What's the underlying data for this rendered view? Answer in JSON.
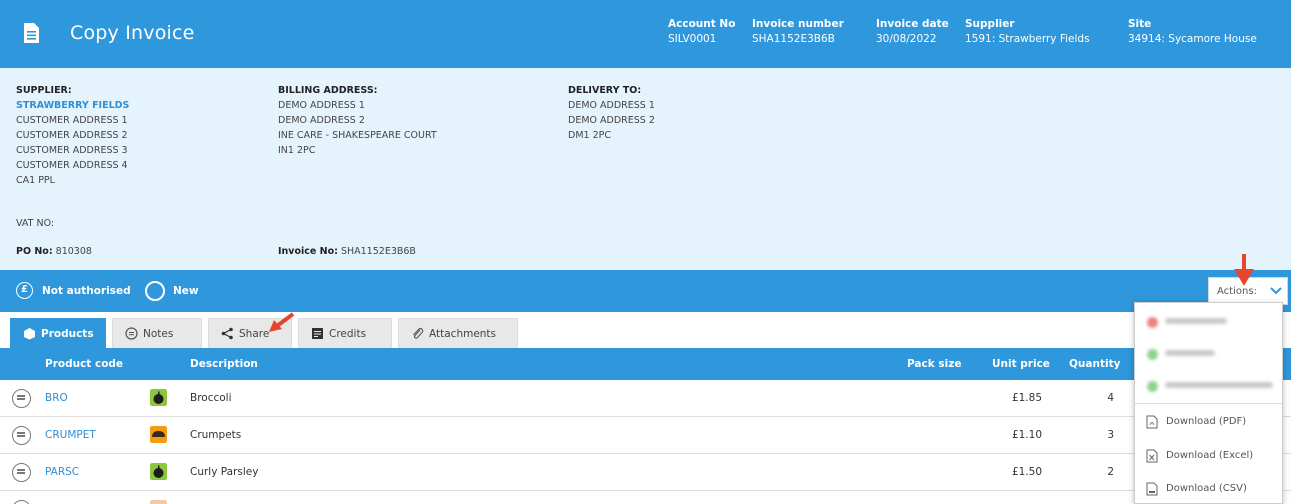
{
  "header": {
    "title": "Copy Invoice",
    "account_no_label": "Account No",
    "account_no": "SILV0001",
    "invoice_number_label": "Invoice number",
    "invoice_number": "SHA1152E3B6B",
    "invoice_date_label": "Invoice date",
    "invoice_date": "30/08/2022",
    "supplier_label": "Supplier",
    "supplier": "1591: Strawberry Fields",
    "site_label": "Site",
    "site": "34914: Sycamore House"
  },
  "supplier": {
    "heading": "SUPPLIER:",
    "name": "STRAWBERRY FIELDS",
    "lines": [
      "CUSTOMER ADDRESS 1",
      "CUSTOMER ADDRESS 2",
      "CUSTOMER ADDRESS 3",
      "CUSTOMER ADDRESS 4",
      "CA1 PPL"
    ],
    "vat_label": "VAT NO:",
    "po_label": "PO No:",
    "po_value": "810308"
  },
  "billing": {
    "heading": "BILLING ADDRESS:",
    "lines": [
      "DEMO ADDRESS 1",
      "DEMO ADDRESS 2",
      "INE CARE - SHAKESPEARE COURT",
      "IN1 2PC"
    ],
    "invoice_no_label": "Invoice No:",
    "invoice_no_value": "SHA1152E3B6B"
  },
  "delivery": {
    "heading": "DELIVERY TO:",
    "lines": [
      "DEMO ADDRESS 1",
      "DEMO ADDRESS 2",
      "DM1 2PC"
    ]
  },
  "status": {
    "auth_icon": "pound-icon",
    "auth_text": "Not authorised",
    "state_icon": "circle-icon",
    "state_text": "New",
    "actions_label": "Actions:"
  },
  "tabs": [
    {
      "label": "Products",
      "icon": "box-icon",
      "active": true
    },
    {
      "label": "Notes",
      "icon": "comment-icon",
      "active": false
    },
    {
      "label": "Share",
      "icon": "share-icon",
      "active": false
    },
    {
      "label": "Credits",
      "icon": "credits-icon",
      "active": false
    },
    {
      "label": "Attachments",
      "icon": "paperclip-icon",
      "active": false
    }
  ],
  "table": {
    "columns": [
      "Product code",
      "Description",
      "Pack size",
      "Unit price",
      "Quantity"
    ],
    "rows": [
      {
        "code": "BRO",
        "category_icon": "apple-icon",
        "description": "Broccoli",
        "unit_price": "£1.85",
        "quantity": "4"
      },
      {
        "code": "CRUMPET",
        "category_icon": "bread-icon",
        "description": "Crumpets",
        "unit_price": "£1.10",
        "quantity": "3"
      },
      {
        "code": "PARSC",
        "category_icon": "apple-icon",
        "description": "Curly Parsley",
        "unit_price": "£1.50",
        "quantity": "2"
      }
    ]
  },
  "actions_menu": {
    "download_items": [
      "Download (PDF)",
      "Download (Excel)",
      "Download (CSV)"
    ]
  },
  "colors": {
    "primary": "#2f97dc",
    "panel": "#e5f3fc",
    "link": "#2f8fd6",
    "annotation_arrow": "#e8452f"
  }
}
